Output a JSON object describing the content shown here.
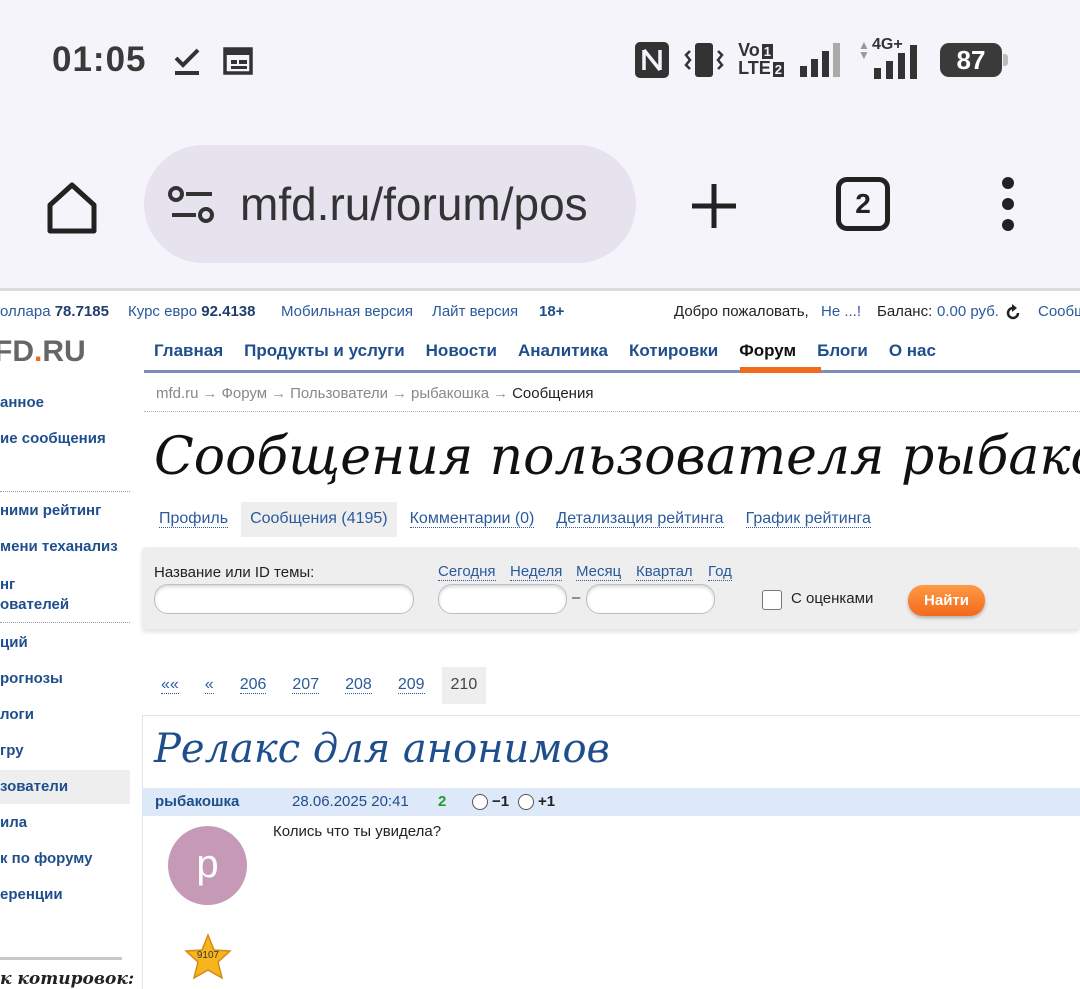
{
  "status_bar": {
    "time": "01:05",
    "signal_type": "4G+",
    "volte_top": "Vo",
    "volte_bottom": "LTE",
    "sim1": "1",
    "sim2": "2",
    "battery": "87"
  },
  "browser": {
    "url": "mfd.ru/forum/pos",
    "tab_count": "2"
  },
  "topbar": {
    "dollar_label": "оллара",
    "dollar_value": "78.7185",
    "euro_label": "Курс евро",
    "euro_value": "92.4138",
    "mobile_link": "Мобильная версия",
    "lite_link": "Лайт версия",
    "age_badge": "18+",
    "welcome_text": "Добро пожаловать,",
    "user_link": "Не ...!",
    "balance_label": "Баланс:",
    "balance_value": "0.00 руб.",
    "cut_link": "Сообщ"
  },
  "logo": {
    "prefix": "FD",
    "dot": ".",
    "suffix": "RU"
  },
  "main_nav": {
    "items": [
      "Главная",
      "Продукты и услуги",
      "Новости",
      "Аналитика",
      "Котировки",
      "Форум",
      "Блоги",
      "О нас"
    ],
    "active": "Форум"
  },
  "sidebar": {
    "items": [
      "анное",
      "ие сообщения",
      "ними рейтинг",
      "мени теханализ",
      "нг",
      "ователей",
      "ций",
      "рогнозы",
      "логи",
      "гру",
      "зователи",
      "ила",
      "к по форуму",
      "еренции"
    ],
    "selected": "зователи",
    "quotes_heading": "к котировок:"
  },
  "breadcrumb": {
    "items": [
      "mfd.ru",
      "Форум",
      "Пользователи",
      "рыбакошка"
    ],
    "separator": "→",
    "current": "Сообщения"
  },
  "page_title": "Сообщения пользователя рыбакошка",
  "subtabs": {
    "items": [
      "Профиль",
      "Сообщения (4195)",
      "Комментарии (0)",
      "Детализация рейтинга",
      "График рейтинга"
    ],
    "active": "Сообщения (4195)"
  },
  "filter": {
    "topic_label": "Название или ID темы:",
    "periods": [
      "Сегодня",
      "Неделя",
      "Месяц",
      "Квартал",
      "Год"
    ],
    "date_separator": "–",
    "with_ratings_label": "С оценками",
    "find_button": "Найти"
  },
  "pager": {
    "first": "««",
    "prev": "«",
    "pages": [
      "206",
      "207",
      "208",
      "209"
    ],
    "current": "210"
  },
  "post": {
    "title": "Релакс для анонимов",
    "author": "рыбакошка",
    "date": "28.06.2025 20:41",
    "rating": "2",
    "vote_minus": "−1",
    "vote_plus": "+1",
    "avatar_letter": "p",
    "avatar_color": "#c699b7",
    "text": "Колись что ты увидела?",
    "star_number": "9107"
  },
  "colors": {
    "link_blue": "#1f4e8c",
    "accent_orange": "#f26a1b",
    "rating_green": "#1f9c2a"
  },
  "icons": {
    "status_left": [
      "download-done-icon",
      "calendar-icon"
    ],
    "status_right": [
      "nfc-icon",
      "vibrate-icon",
      "volte-icon",
      "signal-icon",
      "signal-4g-icon",
      "battery-icon"
    ],
    "toolbar": [
      "home-icon",
      "site-settings-icon",
      "new-tab-icon",
      "tabs-icon",
      "more-vert-icon"
    ],
    "page": [
      "refresh-icon",
      "star-badge-icon"
    ]
  }
}
